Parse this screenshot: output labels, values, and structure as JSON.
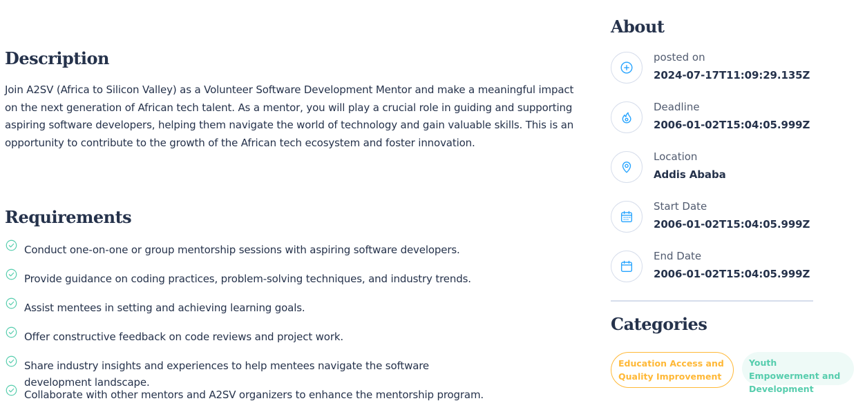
{
  "description": {
    "title": "Description",
    "text": "Join A2SV (Africa to Silicon Valley) as a Volunteer Software Development Mentor and make a meaningful impact on the next generation of African tech talent. As a mentor, you will play a crucial role in guiding and supporting aspiring software developers, helping them navigate the world of technology and gain valuable skills. This is an opportunity to contribute to the growth of the African tech ecosystem and foster innovation."
  },
  "requirements": {
    "title": "Requirements",
    "items": [
      "Conduct one-on-one or group mentorship sessions with aspiring software developers.",
      "Provide guidance on coding practices, problem-solving techniques, and industry trends.",
      "Assist mentees in setting and achieving learning goals.",
      "Offer constructive feedback on code reviews and project work.",
      "Share industry insights and experiences to help mentees navigate the software development landscape.",
      "Collaborate with other mentors and A2SV organizers to enhance the mentorship program."
    ]
  },
  "about": {
    "title": "About",
    "items": [
      {
        "icon": "plus-circle-icon",
        "label": "posted on",
        "value": "2024-07-17T11:09:29.135Z"
      },
      {
        "icon": "fire-icon",
        "label": "Deadline",
        "value": "2006-01-02T15:04:05.999Z"
      },
      {
        "icon": "location-pin-icon",
        "label": "Location",
        "value": "Addis Ababa"
      },
      {
        "icon": "calendar-icon",
        "label": "Start Date",
        "value": "2006-01-02T15:04:05.999Z"
      },
      {
        "icon": "calendar-icon",
        "label": "End Date",
        "value": "2006-01-02T15:04:05.999Z"
      }
    ]
  },
  "categories": {
    "title": "Categories",
    "items": [
      {
        "label": "Education Access and Quality Improvement",
        "color": "#ffb836"
      },
      {
        "label": "Youth Empowerment and Development",
        "color": "#56cdad"
      }
    ]
  },
  "colors": {
    "heading": "#25324b",
    "accent_blue": "#26a4ff",
    "check_green": "#56cdad",
    "border": "#d6ddeb"
  }
}
